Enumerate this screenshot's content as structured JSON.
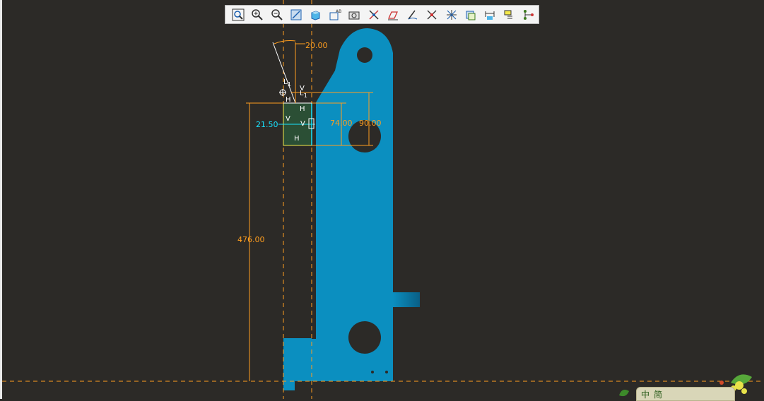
{
  "toolbar": {
    "buttons": [
      {
        "name": "fit-all-button",
        "icon": "fit-all-icon"
      },
      {
        "name": "zoom-in-button",
        "icon": "zoom-in-icon"
      },
      {
        "name": "zoom-out-button",
        "icon": "zoom-out-icon"
      },
      {
        "name": "normal-view-button",
        "icon": "normal-view-icon"
      },
      {
        "name": "shading-button",
        "icon": "cube-icon"
      },
      {
        "name": "view-mode-button",
        "icon": "view-mode-icon"
      },
      {
        "name": "capture-button",
        "icon": "camera-icon"
      },
      {
        "name": "hide-show-button",
        "icon": "hide-show-icon"
      },
      {
        "name": "cut-part-button",
        "icon": "cut-plane-icon"
      },
      {
        "name": "sketch-analysis-button",
        "icon": "sketch-analysis-icon"
      },
      {
        "name": "visualize-constraints-button",
        "icon": "constraints-icon"
      },
      {
        "name": "visualize-geometry-button",
        "icon": "geometry-diagnostic-icon"
      },
      {
        "name": "3d-elements-button",
        "icon": "3d-elements-icon"
      },
      {
        "name": "dimension-constraints-button",
        "icon": "dimension-icon"
      },
      {
        "name": "geometrical-constraints-button",
        "icon": "geometric-constraint-icon"
      },
      {
        "name": "profile-button",
        "icon": "profile-icon"
      }
    ]
  },
  "sketch": {
    "dimensions": {
      "angle": "20.00",
      "height_tall": "476.00",
      "offset": "21.50",
      "height_small": "74.00",
      "height_mid": "90.00"
    },
    "constraint_labels": {
      "l1_a": "L",
      "l1_a_num": "1",
      "l1_b": "L",
      "l1_b_num": "1",
      "v_top": "V",
      "h_top_left": "H",
      "h_top_right": "H",
      "v_left": "V",
      "v_mid": "V",
      "h_bottom": "H"
    },
    "colors": {
      "background": "#2c2a27",
      "part": "#0b8fc0",
      "dimension": "#ff9e1f",
      "constraint": "#ffffff",
      "cyan_dim": "#19e3ff",
      "highlight": "#2b4f35"
    }
  },
  "tray": {
    "items": [
      "中",
      "简"
    ]
  }
}
